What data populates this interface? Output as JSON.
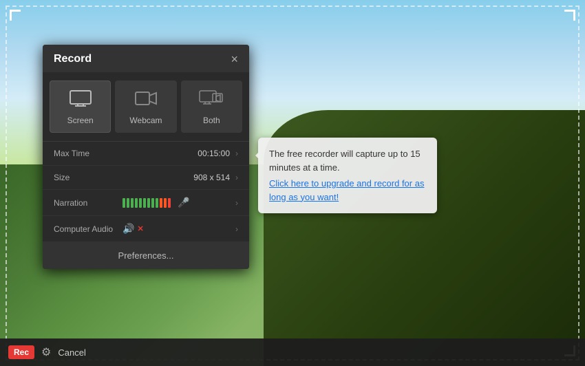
{
  "panel": {
    "title": "Record",
    "close_label": "×"
  },
  "modes": [
    {
      "id": "screen",
      "label": "Screen",
      "active": true,
      "icon": "🖥"
    },
    {
      "id": "webcam",
      "label": "Webcam",
      "active": false,
      "icon": "📷"
    },
    {
      "id": "both",
      "label": "Both",
      "active": false,
      "icon": "🖥"
    }
  ],
  "settings": [
    {
      "label": "Max Time",
      "value": "00:15:00"
    },
    {
      "label": "Size",
      "value": "908 x 514"
    },
    {
      "label": "Narration",
      "value": ""
    },
    {
      "label": "Computer Audio",
      "value": ""
    }
  ],
  "preferences_label": "Preferences...",
  "tooltip": {
    "text": "The free recorder will capture up to 15 minutes at a time.",
    "link_text": "Click here to upgrade and record for as long as you want!"
  },
  "bottom_bar": {
    "rec_label": "Rec",
    "cancel_label": "Cancel"
  },
  "icons": {
    "gear": "⚙",
    "arrow_right": "›",
    "mic": "🎤",
    "speaker": "🔊",
    "mute_x": "×"
  }
}
